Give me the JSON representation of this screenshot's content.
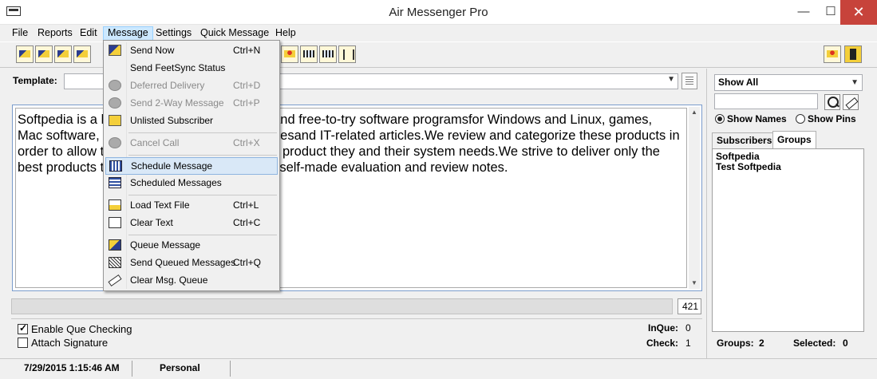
{
  "window": {
    "title": "Air Messenger Pro",
    "minimize": "—",
    "maximize": "☐",
    "close": "✕"
  },
  "menubar": [
    "File",
    "Reports",
    "Edit",
    "Message",
    "Settings",
    "Quick Message",
    "Help"
  ],
  "toolbar": {
    "icons": [
      "send-icon",
      "send-icon",
      "compose-icon",
      "load-icon",
      "status-icon",
      "pager-icon",
      "pager-icon",
      "antenna-icon",
      "user-icon",
      "exit-icon"
    ]
  },
  "template": {
    "label": "Template:",
    "value": ""
  },
  "editor": {
    "text": "Softpedia is a library of over 1,300,000 free and free-to-try software programsfor Windows and Linux, games, Mac software, Windows drivers, mobile devicesand IT-related articles.We review and categorize these products in order to allow the visitor/userto find the exact product they and their system needs.We strive to deliver only the best products to the visitor/usertogether with self-made evaluation and review notes."
  },
  "char_count": "421",
  "options": {
    "enable_que_checking": {
      "label": "Enable Que Checking",
      "checked": true
    },
    "attach_signature": {
      "label": "Attach Signature",
      "checked": false
    }
  },
  "stats": {
    "inque_label": "InQue:",
    "inque_value": "0",
    "check_label": "Check:",
    "check_value": "1"
  },
  "statusbar": {
    "datetime": "7/29/2015 1:15:46 AM",
    "profile": "Personal"
  },
  "right_panel": {
    "filter": "Show All",
    "search_value": "",
    "show_names": "Show Names",
    "show_pins": "Show Pins",
    "show_mode": "names",
    "tabs": [
      "Subscribers",
      "Groups"
    ],
    "active_tab": "Groups",
    "groups": [
      "Softpedia",
      "Test Softpedia"
    ],
    "groups_label": "Groups:",
    "groups_count": "2",
    "selected_label": "Selected:",
    "selected_count": "0"
  },
  "message_menu": {
    "items": [
      {
        "label": "Send Now",
        "shortcut": "Ctrl+N",
        "icon": "send-envelope-icon",
        "disabled": false
      },
      {
        "label": "Send FeetSync Status",
        "shortcut": "",
        "icon": "",
        "disabled": false
      },
      {
        "label": "Deferred Delivery",
        "shortcut": "Ctrl+D",
        "icon": "clock-icon",
        "disabled": true
      },
      {
        "label": "Send 2-Way Message",
        "shortcut": "Ctrl+P",
        "icon": "two-way-icon",
        "disabled": true
      },
      {
        "label": "Unlisted Subscriber",
        "shortcut": "",
        "icon": "tap-icon",
        "disabled": false
      },
      {
        "label": "Cancel Call",
        "shortcut": "Ctrl+X",
        "icon": "cancel-call-icon",
        "disabled": true
      },
      {
        "label": "Schedule Message",
        "shortcut": "",
        "icon": "calendar-icon",
        "disabled": false,
        "highlighted": true
      },
      {
        "label": "Scheduled Messages",
        "shortcut": "",
        "icon": "calendar-list-icon",
        "disabled": false
      },
      {
        "label": "Load Text File",
        "shortcut": "Ctrl+L",
        "icon": "load-file-icon",
        "disabled": false
      },
      {
        "label": "Clear Text",
        "shortcut": "Ctrl+C",
        "icon": "clear-text-icon",
        "disabled": false
      },
      {
        "label": "Queue Message",
        "shortcut": "",
        "icon": "queue-icon",
        "disabled": false
      },
      {
        "label": "Send Queued Messages",
        "shortcut": "Ctrl+Q",
        "icon": "send-queued-icon",
        "disabled": false
      },
      {
        "label": "Clear Msg. Queue",
        "shortcut": "",
        "icon": "eraser-icon",
        "disabled": false
      }
    ]
  }
}
